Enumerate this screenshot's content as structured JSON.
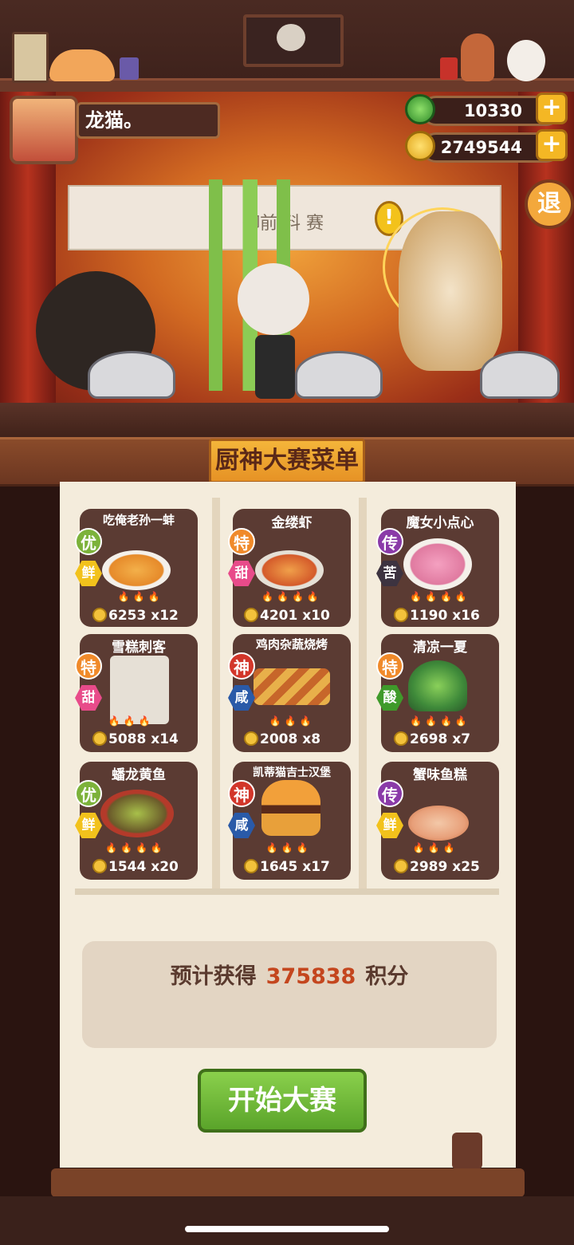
{
  "player": {
    "name": "龙猫。"
  },
  "currency": {
    "jade": "10330",
    "coins": "2749544"
  },
  "buttons": {
    "plus": "+",
    "exit": "退",
    "start": "开始大赛"
  },
  "stage": {
    "banner_text": "御前    料     赛"
  },
  "menu": {
    "title": "厨神大赛菜单",
    "dishes": [
      {
        "name": "吃俺老孙一蚌",
        "quality": "优",
        "flavor": "鲜",
        "price": "6253",
        "count": "x12"
      },
      {
        "name": "金缕虾",
        "quality": "特",
        "flavor": "甜",
        "price": "4201",
        "count": "x10"
      },
      {
        "name": "魔女小点心",
        "quality": "传",
        "flavor": "苦",
        "price": "1190",
        "count": "x16"
      },
      {
        "name": "雪糕刺客",
        "quality": "特",
        "flavor": "甜",
        "price": "5088",
        "count": "x14"
      },
      {
        "name": "鸡肉杂蔬烧烤",
        "quality": "神",
        "flavor": "咸",
        "price": "2008",
        "count": "x8"
      },
      {
        "name": "清凉一夏",
        "quality": "特",
        "flavor": "酸",
        "price": "2698",
        "count": "x7"
      },
      {
        "name": "蟠龙黄鱼",
        "quality": "优",
        "flavor": "鲜",
        "price": "1544",
        "count": "x20"
      },
      {
        "name": "凯蒂猫吉士汉堡",
        "quality": "神",
        "flavor": "咸",
        "price": "1645",
        "count": "x17"
      },
      {
        "name": "蟹味鱼糕",
        "quality": "传",
        "flavor": "鲜",
        "price": "2989",
        "count": "x25"
      }
    ]
  },
  "summary": {
    "prefix": "预计获得",
    "points": "375838",
    "suffix": "积分"
  },
  "colors": {
    "quality_you": "#7cb23a",
    "quality_te": "#f08a2a",
    "quality_chuan": "#8a3aa8",
    "quality_shen": "#d2362a",
    "flavor_xian": "#f2c21c",
    "flavor_tian": "#e84b8a",
    "flavor_ku": "#3d3340",
    "flavor_xian2": "#2a5aa8",
    "flavor_suan": "#3f9a2a"
  }
}
